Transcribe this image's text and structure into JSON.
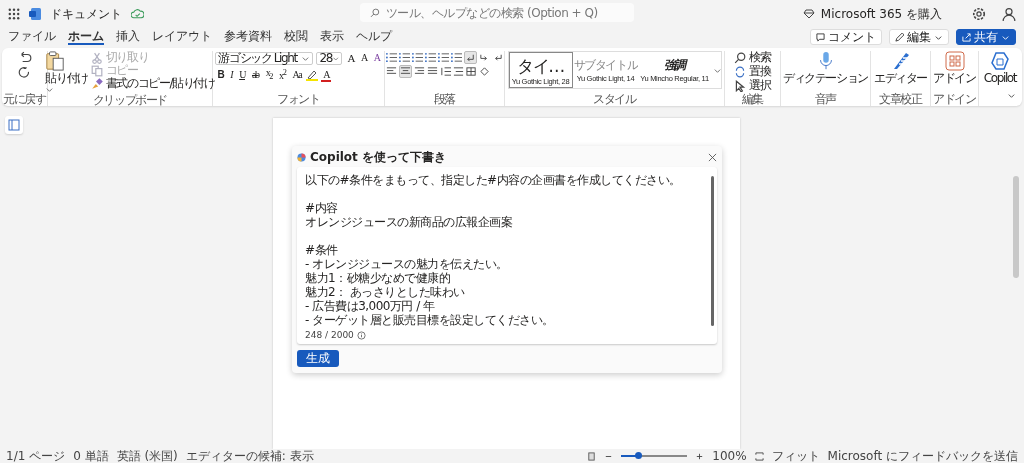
{
  "titlebar": {
    "document_title": "ドキュメント",
    "search": {
      "placeholder": "ツール、ヘルプなどの検索 (Option + Q)"
    },
    "buy": "Microsoft 365 を購入"
  },
  "tabs": [
    {
      "label": "ファイル",
      "selected": false
    },
    {
      "label": "ホーム",
      "selected": true
    },
    {
      "label": "挿入",
      "selected": false
    },
    {
      "label": "レイアウト",
      "selected": false
    },
    {
      "label": "参考資料",
      "selected": false
    },
    {
      "label": "校閲",
      "selected": false
    },
    {
      "label": "表示",
      "selected": false
    },
    {
      "label": "ヘルプ",
      "selected": false
    }
  ],
  "actions": {
    "comment": "コメント",
    "edit": "編集",
    "share": "共有"
  },
  "ribbon": {
    "undo": {
      "label": "元に戻す"
    },
    "clipboard": {
      "paste": "貼り付け",
      "cut": {
        "label": "切り取り",
        "disabled": true
      },
      "copy": {
        "label": "コピー",
        "disabled": true
      },
      "format_painter": {
        "label": "書式のコピー/貼り付け",
        "disabled": false
      },
      "label": "クリップボード"
    },
    "font": {
      "font_name": "游ゴシック Light",
      "font_size": "28",
      "grow": "A",
      "shrink": "A",
      "clear": "A",
      "formats": [
        "B",
        "I",
        "U",
        "ab",
        "x$_{2}$",
        "x$^{2}$",
        "Aa"
      ],
      "color_letter": "A",
      "label": "フォント"
    },
    "paragraph": {
      "show_marks": true,
      "alignments": [
        {
          "selected": false
        },
        {
          "selected": true
        },
        {
          "selected": false
        },
        {
          "selected": false
        }
      ],
      "label": "段落"
    },
    "styles": {
      "items": [
        {
          "sample": "タイ…",
          "caption": "Yu Gothic Light, 28",
          "selected": true
        },
        {
          "sample": "サブタイトル",
          "caption": "Yu Gothic Light, 14",
          "selected": false
        },
        {
          "sample": "強調",
          "caption": "Yu Mincho Regular, 11",
          "selected": false
        }
      ],
      "label": "スタイル"
    },
    "editing": {
      "find": "検索",
      "replace": "置換",
      "select": "選択",
      "label": "編集"
    },
    "voice": {
      "dictate": "ディクテーション",
      "label": "音声"
    },
    "proofing": {
      "editor": "エディター",
      "label": "文章校正"
    },
    "addins": {
      "addins": "アドイン",
      "label": "アドイン"
    },
    "copilot": {
      "label": "Copilot"
    }
  },
  "dialog": {
    "title": "Copilot を使って下書き",
    "prompt": [
      [
        "以下の#条件をまもって、指定した#内容の企画書を作成してください。"
      ],
      [
        "#内容",
        "オレンジジュースの新商品の広報企画案"
      ],
      [
        "#条件",
        "- オレンジジュースの魅力を伝えたい。",
        "魅力1：砂糖少なめで健康的",
        "魅力2： あっさりとした味わい",
        "- 広告費は3,000万円 / 年",
        "- ターゲット層と販売目標を設定してください。"
      ]
    ],
    "counter": "248 / 2000",
    "generate": "生成"
  },
  "status_bar": {
    "items": [
      "1/1 ページ",
      "0 単語",
      "英語 (米国)",
      "エディターの候補: 表示"
    ],
    "zoom": {
      "level": 0.25,
      "percent": "100%"
    },
    "fit": "フィット",
    "feedback": "Microsoft にフィードバックを送信"
  }
}
